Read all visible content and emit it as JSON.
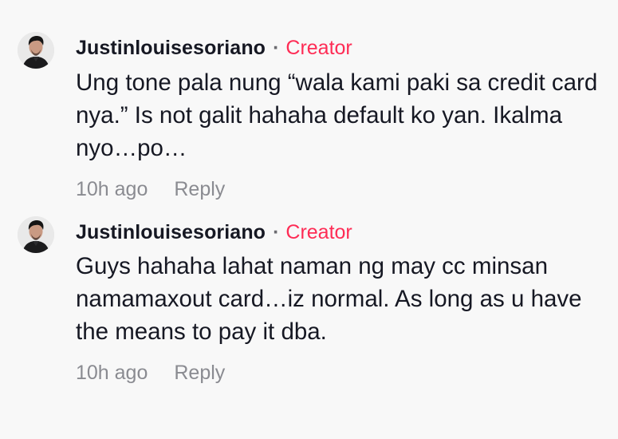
{
  "comments": [
    {
      "username": "Justinlouisesoriano",
      "separator": "·",
      "badge": "Creator",
      "text": "Ung tone pala nung “wala kami paki sa credit card nya.” Is not galit hahaha default ko yan. Ikalma nyo…po…",
      "time": "10h ago",
      "reply_label": "Reply"
    },
    {
      "username": "Justinlouisesoriano",
      "separator": "·",
      "badge": "Creator",
      "text": "Guys hahaha lahat naman ng may cc minsan namamaxout card…iz normal. As long as u have the means to pay it dba.",
      "time": "10h ago",
      "reply_label": "Reply"
    }
  ],
  "colors": {
    "background": "#f8f8f8",
    "text": "#161823",
    "creator_badge": "#fe2c55",
    "meta": "#8a8b91"
  }
}
